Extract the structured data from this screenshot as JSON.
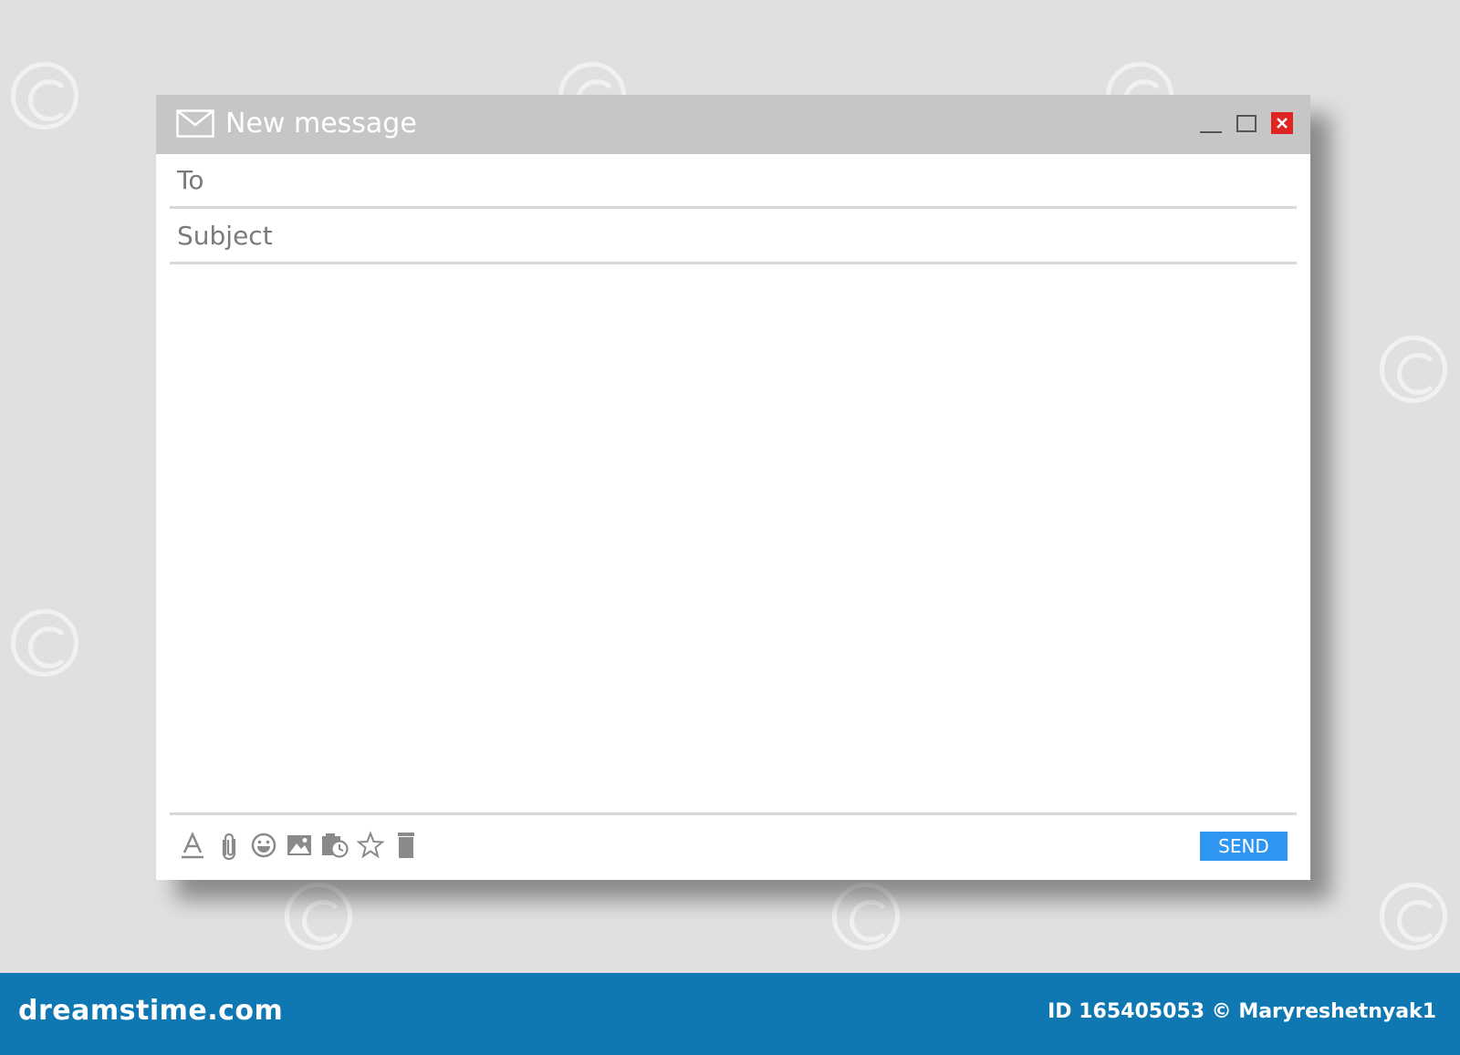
{
  "window": {
    "title": "New message",
    "controls": {
      "minimize_icon": "minimize-icon",
      "maximize_icon": "maximize-icon",
      "close_icon": "close-icon"
    }
  },
  "compose": {
    "to_placeholder": "To",
    "subject_placeholder": "Subject",
    "body_value": ""
  },
  "toolbar": {
    "icons": [
      "text-format-icon",
      "attachment-icon",
      "emoji-icon",
      "image-icon",
      "schedule-icon",
      "star-icon",
      "trash-icon"
    ],
    "send_label": "SEND"
  },
  "footer": {
    "brand": "dreamstime.com",
    "credit": "ID 165405053 © Maryreshetnyak1"
  },
  "colors": {
    "background": "#e0e0e0",
    "titlebar": "#c6c6c6",
    "close": "#e02424",
    "send": "#2f95f2",
    "footer": "#0f78b2"
  }
}
